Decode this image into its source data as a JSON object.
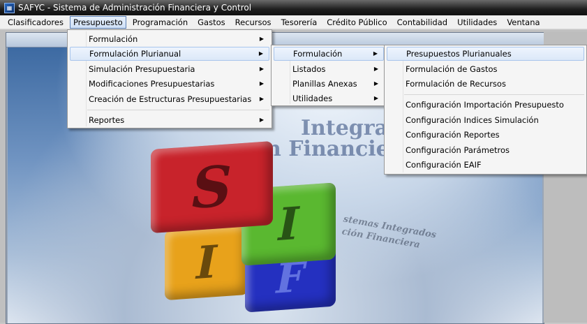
{
  "window": {
    "title": "SAFYC - Sistema de Administración Financiera y Control",
    "icon": "app-icon"
  },
  "menubar": {
    "items": [
      "Clasificadores",
      "Presupuesto",
      "Programación",
      "Gastos",
      "Recursos",
      "Tesorería",
      "Crédito Público",
      "Contabilidad",
      "Utilidades",
      "Ventana"
    ],
    "active": "Presupuesto"
  },
  "menu_presupuesto": {
    "items": [
      "Formulación",
      "Formulación Plurianual",
      "Simulación Presupuestaria",
      "Modificaciones Presupuestarias",
      "Creación de Estructuras Presupuestarias",
      "Reportes"
    ],
    "highlighted": "Formulación Plurianual"
  },
  "menu_plurianual": {
    "items": [
      "Formulación",
      "Listados",
      "Planillas Anexas",
      "Utilidades"
    ],
    "highlighted": "Formulación"
  },
  "menu_formulacion": {
    "items": [
      "Presupuestos Plurianuales",
      "Formulación de Gastos",
      "Formulación de Recursos",
      "Configuración Importación Presupuesto",
      "Configuración Indices Simulación",
      "Configuración Reportes",
      "Configuración Parámetros",
      "Configuración EAIF"
    ],
    "highlighted": "Presupuestos Plurianuales"
  },
  "splash": {
    "cube_letters": [
      "S",
      "I",
      "I",
      "F"
    ],
    "watermark_1": "Integra",
    "watermark_2": "n Financie",
    "caption_1": "stemas Integrados",
    "caption_2": "ción Financiera"
  }
}
